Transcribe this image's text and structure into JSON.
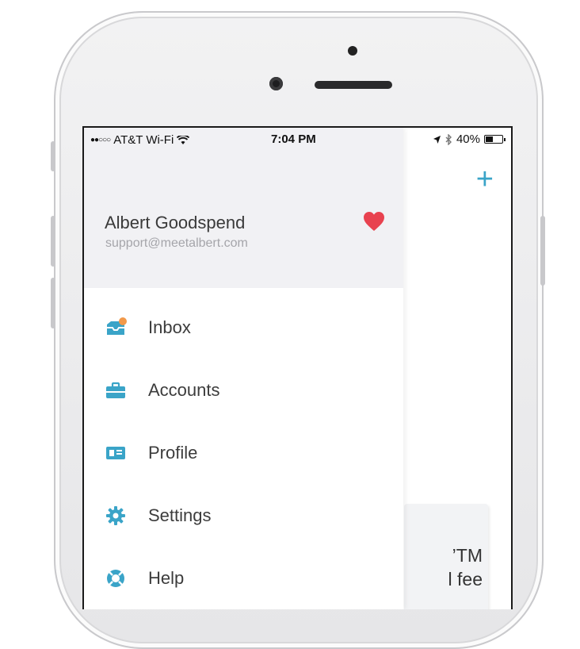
{
  "status_bar": {
    "carrier": "AT&T Wi-Fi",
    "time": "7:04 PM",
    "battery": "40%",
    "battery_level": 0.4
  },
  "drawer": {
    "user_name": "Albert Goodspend",
    "user_email": "support@meetalbert.com",
    "menu_items": [
      {
        "label": "Inbox",
        "icon": "inbox-icon"
      },
      {
        "label": "Accounts",
        "icon": "briefcase-icon"
      },
      {
        "label": "Profile",
        "icon": "id-card-icon"
      },
      {
        "label": "Settings",
        "icon": "gear-icon"
      },
      {
        "label": "Help",
        "icon": "lifebuoy-icon"
      }
    ]
  },
  "background": {
    "add_label": "+",
    "card_line1": "’TM",
    "card_line2": "l fee"
  },
  "colors": {
    "accent": "#3aa4c8",
    "heart": "#e8424f",
    "badge": "#f2994a",
    "header_bg": "#f1f1f4"
  }
}
